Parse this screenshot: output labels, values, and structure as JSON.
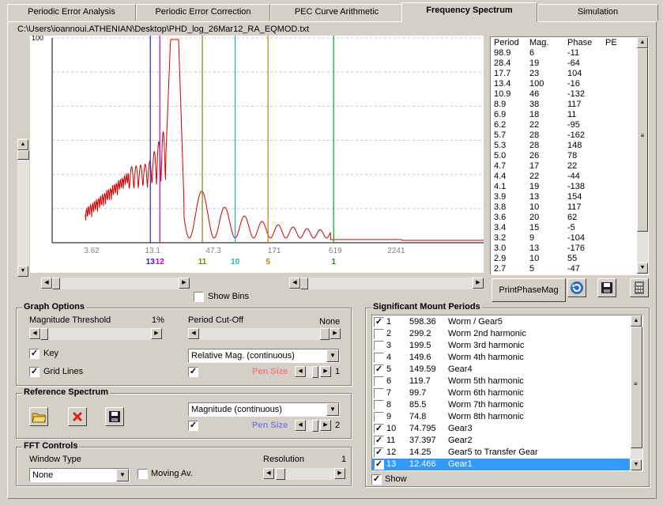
{
  "tabs": [
    {
      "label": "Periodic Error Analysis"
    },
    {
      "label": "Periodic Error Correction"
    },
    {
      "label": "PEC Curve Arithmetic"
    },
    {
      "label": "Frequency Spectrum"
    },
    {
      "label": "Simulation"
    }
  ],
  "file_path": "C:\\Users\\ioannoui.ATHENIAN\\Desktop\\PHD_log_26Mar12_RA_EQMOD.txt",
  "chart_data": {
    "type": "line",
    "title": "",
    "xlabel": "",
    "ylabel": "",
    "x_scale": "log",
    "y_top_label": "100",
    "x_tick_labels": [
      "3.62",
      "13.1",
      "47.3",
      "171",
      "619",
      "2241"
    ],
    "grid": true,
    "series_color": "#d00000",
    "period_markers": [
      {
        "label": "13",
        "period": 12.466,
        "color": "#2020c0"
      },
      {
        "label": "12",
        "period": 14.25,
        "color": "#c000c0"
      },
      {
        "label": "11",
        "period": 37.397,
        "color": "#808000"
      },
      {
        "label": "10",
        "period": 74.795,
        "color": "#20b0b0"
      },
      {
        "label": "5",
        "period": 149.59,
        "color": "#c08000"
      },
      {
        "label": "1",
        "period": 598.36,
        "color": "#10a010"
      }
    ]
  },
  "show_bins_label": "Show Bins",
  "phase_table": {
    "headers": [
      "Period",
      "Mag.",
      "Phase",
      "PE"
    ],
    "rows": [
      [
        "98.9",
        "6",
        "-11"
      ],
      [
        "28.4",
        "19",
        "-64"
      ],
      [
        "17.7",
        "23",
        "104"
      ],
      [
        "13.4",
        "100",
        "-16"
      ],
      [
        "10.9",
        "46",
        "-132"
      ],
      [
        "8.9",
        "38",
        "117"
      ],
      [
        "6.9",
        "18",
        "11"
      ],
      [
        "6.2",
        "22",
        "-95"
      ],
      [
        "5.7",
        "28",
        "-162"
      ],
      [
        "5.3",
        "28",
        "148"
      ],
      [
        "5.0",
        "26",
        "78"
      ],
      [
        "4.7",
        "17",
        "22"
      ],
      [
        "4.4",
        "22",
        "-44"
      ],
      [
        "4.1",
        "19",
        "-138"
      ],
      [
        "3.9",
        "13",
        "154"
      ],
      [
        "3.8",
        "10",
        "117"
      ],
      [
        "3.6",
        "20",
        "62"
      ],
      [
        "3.4",
        "15",
        "-5"
      ],
      [
        "3.2",
        "9",
        "-104"
      ],
      [
        "3.0",
        "13",
        "-176"
      ],
      [
        "2.9",
        "10",
        "55"
      ],
      [
        "2.7",
        "5",
        "-47"
      ]
    ]
  },
  "print_button": "PrintPhaseMag",
  "graph_options": {
    "title": "Graph Options",
    "mag_threshold_label": "Magnitude Threshold",
    "mag_threshold_value": "1%",
    "period_cutoff_label": "Period Cut-Off",
    "period_cutoff_value": "None",
    "key_label": "Key",
    "grid_lines_label": "Grid Lines",
    "mode_select": "Relative Mag. (continuous)",
    "pen_size_label": "Pen Size",
    "pen_size_value": "1",
    "pen_color": "#f08080"
  },
  "reference_spectrum": {
    "title": "Reference Spectrum",
    "mode_select": "Magnitude (continuous)",
    "pen_size_label": "Pen Size",
    "pen_size_value": "2",
    "pen_color": "#8080e0"
  },
  "fft_controls": {
    "title": "FFT Controls",
    "window_type_label": "Window Type",
    "window_type_value": "None",
    "moving_av_label": "Moving Av.",
    "resolution_label": "Resolution",
    "resolution_value": "1"
  },
  "mount_periods": {
    "title": "Significant Mount Periods",
    "show_label": "Show",
    "rows": [
      {
        "checked": true,
        "n": "1",
        "period": "598.36",
        "name": "Worm / Gear5"
      },
      {
        "checked": false,
        "n": "2",
        "period": "299.2",
        "name": "Worm 2nd harmonic"
      },
      {
        "checked": false,
        "n": "3",
        "period": "199.5",
        "name": "Worm 3rd harmonic"
      },
      {
        "checked": false,
        "n": "4",
        "period": "149.6",
        "name": "Worm 4th harmonic"
      },
      {
        "checked": true,
        "n": "5",
        "period": "149.59",
        "name": "Gear4"
      },
      {
        "checked": false,
        "n": "6",
        "period": "119.7",
        "name": "Worm 5th harmonic"
      },
      {
        "checked": false,
        "n": "7",
        "period": "99.7",
        "name": "Worm 6th harmonic"
      },
      {
        "checked": false,
        "n": "8",
        "period": "85.5",
        "name": "Worm 7th harmonic"
      },
      {
        "checked": false,
        "n": "9",
        "period": "74.8",
        "name": "Worm 8th harmonic"
      },
      {
        "checked": true,
        "n": "10",
        "period": "74.795",
        "name": "Gear3"
      },
      {
        "checked": true,
        "n": "11",
        "period": "37.397",
        "name": "Gear2"
      },
      {
        "checked": true,
        "n": "12",
        "period": "14.25",
        "name": "Gear5 to Transfer Gear"
      },
      {
        "checked": true,
        "n": "13",
        "period": "12.466",
        "name": "Gear1",
        "selected": true
      }
    ]
  }
}
